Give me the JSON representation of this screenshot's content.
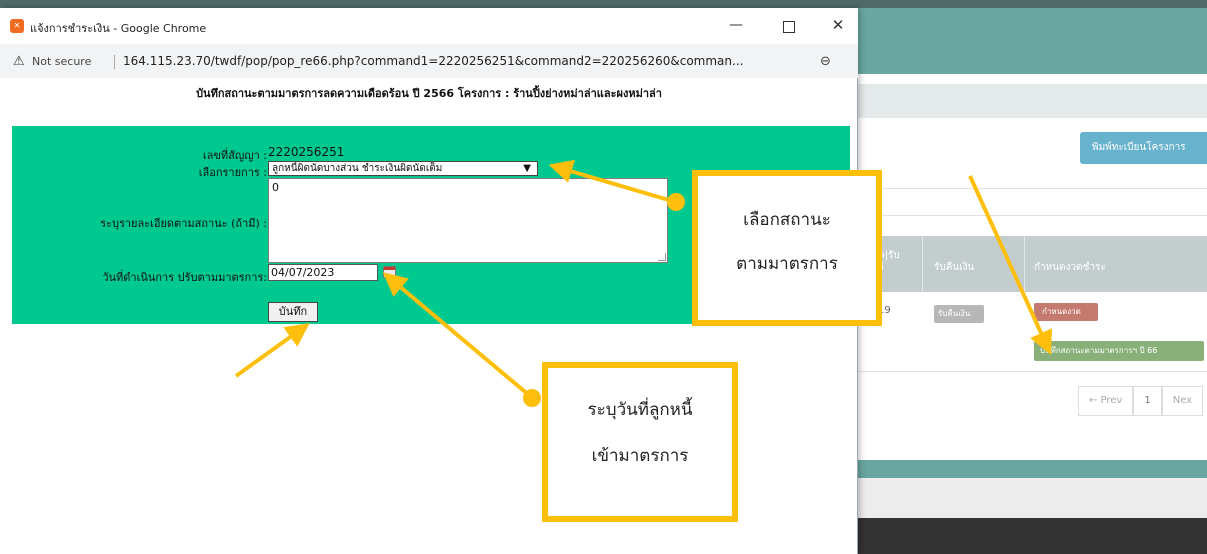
{
  "popup": {
    "window_title": "แจ้งการชำระเงิน - Google Chrome",
    "not_secure": "Not secure",
    "url": "164.115.23.70/twdf/pop/pop_re66.php?command1=2220256251&command2=220256260&comman...",
    "heading": "บันทึกสถานะตามมาตรการลดความเดือดร้อน ปี 2566 โครงการ : ร้านปิ้งย่างหม่าล่าและผงหม่าล่า",
    "form": {
      "contract_label": "เลขที่สัญญา :",
      "contract_value": "2220256251",
      "status_label": "เลือกรายการ :",
      "status_selected": "ลูกหนี้ผิดนัดบางส่วน ชำระเงินผิดนัดเต็ม",
      "detail_label": "ระบุรายละเอียดตามสถานะ (ถ้ามี) :",
      "detail_value": "0",
      "date_label": "วันที่ดำเนินการ ปรับตามมาตรการ:",
      "date_value": "04/07/2023",
      "save_label": "บันทึก"
    }
  },
  "background": {
    "print_button": "พิมพ์ทะเบียนโครงการ",
    "columns": [
      "ค|รับ\nว้",
      "รับคืนเงิน",
      "กำหนดงวดชำระ"
    ],
    "row_value": "19",
    "receive_button": "รับคืนเงิน",
    "period_button": "กำหนดงวด",
    "status_button": "บันทึกสถานะตามมาตรการฯ ปี 66",
    "pager": [
      "← Prev",
      "1",
      "Nex"
    ]
  },
  "annotations": {
    "status_callout_line1": "เลือกสถานะ",
    "status_callout_line2": "ตามมาตรการ",
    "date_callout_line1": "ระบุวันที่ลูกหนี้",
    "date_callout_line2": "เข้ามาตรการ"
  },
  "colors": {
    "form_bg": "#00c990",
    "annotation": "#fdbf0c",
    "header_teal": "#6aa6a0"
  }
}
